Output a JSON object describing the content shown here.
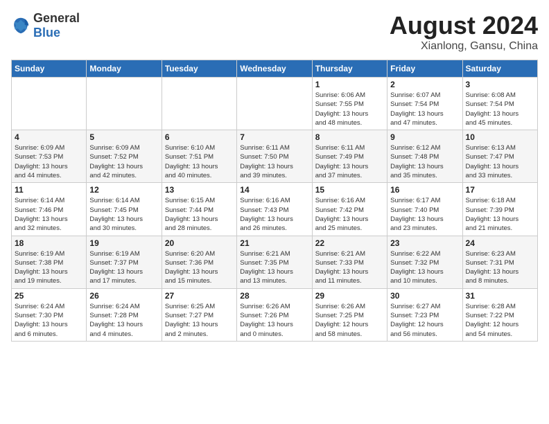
{
  "header": {
    "logo_general": "General",
    "logo_blue": "Blue",
    "month_year": "August 2024",
    "location": "Xianlong, Gansu, China"
  },
  "weekdays": [
    "Sunday",
    "Monday",
    "Tuesday",
    "Wednesday",
    "Thursday",
    "Friday",
    "Saturday"
  ],
  "weeks": [
    [
      {
        "day": "",
        "info": ""
      },
      {
        "day": "",
        "info": ""
      },
      {
        "day": "",
        "info": ""
      },
      {
        "day": "",
        "info": ""
      },
      {
        "day": "1",
        "info": "Sunrise: 6:06 AM\nSunset: 7:55 PM\nDaylight: 13 hours\nand 48 minutes."
      },
      {
        "day": "2",
        "info": "Sunrise: 6:07 AM\nSunset: 7:54 PM\nDaylight: 13 hours\nand 47 minutes."
      },
      {
        "day": "3",
        "info": "Sunrise: 6:08 AM\nSunset: 7:54 PM\nDaylight: 13 hours\nand 45 minutes."
      }
    ],
    [
      {
        "day": "4",
        "info": "Sunrise: 6:09 AM\nSunset: 7:53 PM\nDaylight: 13 hours\nand 44 minutes."
      },
      {
        "day": "5",
        "info": "Sunrise: 6:09 AM\nSunset: 7:52 PM\nDaylight: 13 hours\nand 42 minutes."
      },
      {
        "day": "6",
        "info": "Sunrise: 6:10 AM\nSunset: 7:51 PM\nDaylight: 13 hours\nand 40 minutes."
      },
      {
        "day": "7",
        "info": "Sunrise: 6:11 AM\nSunset: 7:50 PM\nDaylight: 13 hours\nand 39 minutes."
      },
      {
        "day": "8",
        "info": "Sunrise: 6:11 AM\nSunset: 7:49 PM\nDaylight: 13 hours\nand 37 minutes."
      },
      {
        "day": "9",
        "info": "Sunrise: 6:12 AM\nSunset: 7:48 PM\nDaylight: 13 hours\nand 35 minutes."
      },
      {
        "day": "10",
        "info": "Sunrise: 6:13 AM\nSunset: 7:47 PM\nDaylight: 13 hours\nand 33 minutes."
      }
    ],
    [
      {
        "day": "11",
        "info": "Sunrise: 6:14 AM\nSunset: 7:46 PM\nDaylight: 13 hours\nand 32 minutes."
      },
      {
        "day": "12",
        "info": "Sunrise: 6:14 AM\nSunset: 7:45 PM\nDaylight: 13 hours\nand 30 minutes."
      },
      {
        "day": "13",
        "info": "Sunrise: 6:15 AM\nSunset: 7:44 PM\nDaylight: 13 hours\nand 28 minutes."
      },
      {
        "day": "14",
        "info": "Sunrise: 6:16 AM\nSunset: 7:43 PM\nDaylight: 13 hours\nand 26 minutes."
      },
      {
        "day": "15",
        "info": "Sunrise: 6:16 AM\nSunset: 7:42 PM\nDaylight: 13 hours\nand 25 minutes."
      },
      {
        "day": "16",
        "info": "Sunrise: 6:17 AM\nSunset: 7:40 PM\nDaylight: 13 hours\nand 23 minutes."
      },
      {
        "day": "17",
        "info": "Sunrise: 6:18 AM\nSunset: 7:39 PM\nDaylight: 13 hours\nand 21 minutes."
      }
    ],
    [
      {
        "day": "18",
        "info": "Sunrise: 6:19 AM\nSunset: 7:38 PM\nDaylight: 13 hours\nand 19 minutes."
      },
      {
        "day": "19",
        "info": "Sunrise: 6:19 AM\nSunset: 7:37 PM\nDaylight: 13 hours\nand 17 minutes."
      },
      {
        "day": "20",
        "info": "Sunrise: 6:20 AM\nSunset: 7:36 PM\nDaylight: 13 hours\nand 15 minutes."
      },
      {
        "day": "21",
        "info": "Sunrise: 6:21 AM\nSunset: 7:35 PM\nDaylight: 13 hours\nand 13 minutes."
      },
      {
        "day": "22",
        "info": "Sunrise: 6:21 AM\nSunset: 7:33 PM\nDaylight: 13 hours\nand 11 minutes."
      },
      {
        "day": "23",
        "info": "Sunrise: 6:22 AM\nSunset: 7:32 PM\nDaylight: 13 hours\nand 10 minutes."
      },
      {
        "day": "24",
        "info": "Sunrise: 6:23 AM\nSunset: 7:31 PM\nDaylight: 13 hours\nand 8 minutes."
      }
    ],
    [
      {
        "day": "25",
        "info": "Sunrise: 6:24 AM\nSunset: 7:30 PM\nDaylight: 13 hours\nand 6 minutes."
      },
      {
        "day": "26",
        "info": "Sunrise: 6:24 AM\nSunset: 7:28 PM\nDaylight: 13 hours\nand 4 minutes."
      },
      {
        "day": "27",
        "info": "Sunrise: 6:25 AM\nSunset: 7:27 PM\nDaylight: 13 hours\nand 2 minutes."
      },
      {
        "day": "28",
        "info": "Sunrise: 6:26 AM\nSunset: 7:26 PM\nDaylight: 13 hours\nand 0 minutes."
      },
      {
        "day": "29",
        "info": "Sunrise: 6:26 AM\nSunset: 7:25 PM\nDaylight: 12 hours\nand 58 minutes."
      },
      {
        "day": "30",
        "info": "Sunrise: 6:27 AM\nSunset: 7:23 PM\nDaylight: 12 hours\nand 56 minutes."
      },
      {
        "day": "31",
        "info": "Sunrise: 6:28 AM\nSunset: 7:22 PM\nDaylight: 12 hours\nand 54 minutes."
      }
    ]
  ]
}
